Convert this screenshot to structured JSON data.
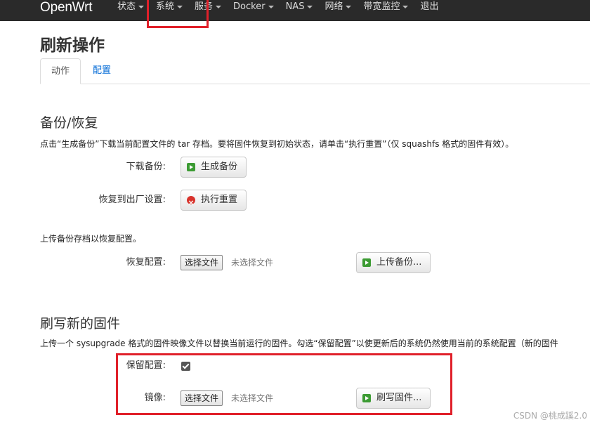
{
  "navbar": {
    "brand": "OpenWrt",
    "items": [
      {
        "label": "状态",
        "caret": true
      },
      {
        "label": "系统",
        "caret": true
      },
      {
        "label": "服务",
        "caret": true
      },
      {
        "label": "Docker",
        "caret": true
      },
      {
        "label": "NAS",
        "caret": true
      },
      {
        "label": "网络",
        "caret": true
      },
      {
        "label": "带宽监控",
        "caret": true
      },
      {
        "label": "退出",
        "caret": false
      }
    ]
  },
  "page": {
    "title": "刷新操作",
    "tabs": [
      {
        "label": "动作",
        "active": true
      },
      {
        "label": "配置",
        "active": false
      }
    ]
  },
  "backup": {
    "title": "备份/恢复",
    "description": "点击“生成备份”下载当前配置文件的 tar 存档。要将固件恢复到初始状态，请单击“执行重置”（仅 squashfs 格式的固件有效）。",
    "download_label": "下载备份:",
    "generate_button": "生成备份",
    "reset_label": "恢复到出厂设置:",
    "reset_button": "执行重置",
    "upload_desc": "上传备份存档以恢复配置。",
    "restore_label": "恢复配置:",
    "choose_file": "选择文件",
    "no_file": "未选择文件",
    "upload_button": "上传备份..."
  },
  "firmware": {
    "title": "刷写新的固件",
    "description": "上传一个 sysupgrade 格式的固件映像文件以替换当前运行的固件。勾选“保留配置”以使更新后的系统仍然使用当前的系统配置（新的固件",
    "keep_label": "保留配置:",
    "keep_checked": true,
    "image_label": "镜像:",
    "choose_file": "选择文件",
    "no_file": "未选择文件",
    "flash_button": "刷写固件..."
  },
  "watermark": "CSDN @桃成蹊2.0",
  "colors": {
    "navbar_bg": "#2a2a2a",
    "highlight": "#e0202a",
    "link": "#0069d6"
  }
}
